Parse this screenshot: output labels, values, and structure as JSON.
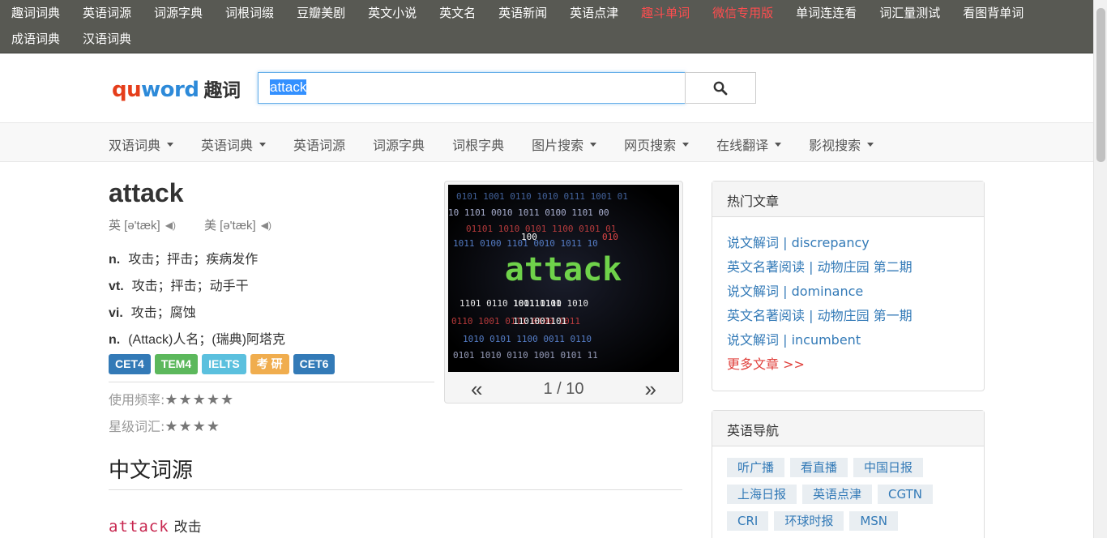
{
  "topbar": {
    "row1": [
      {
        "label": "趣词词典",
        "highlight": false
      },
      {
        "label": "英语词源",
        "highlight": false
      },
      {
        "label": "词源字典",
        "highlight": false
      },
      {
        "label": "词根词缀",
        "highlight": false
      },
      {
        "label": "豆瓣美剧",
        "highlight": false
      },
      {
        "label": "英文小说",
        "highlight": false
      },
      {
        "label": "英文名",
        "highlight": false
      },
      {
        "label": "英语新闻",
        "highlight": false
      },
      {
        "label": "英语点津",
        "highlight": false
      },
      {
        "label": "趣斗单词",
        "highlight": true
      },
      {
        "label": "微信专用版",
        "highlight": true
      },
      {
        "label": "单词连连看",
        "highlight": false
      },
      {
        "label": "词汇量测试",
        "highlight": false
      },
      {
        "label": "看图背单词",
        "highlight": false
      }
    ],
    "row2": [
      {
        "label": "成语词典"
      },
      {
        "label": "汉语词典"
      }
    ]
  },
  "header": {
    "logo_qu": "qu",
    "logo_word": "word",
    "logo_cn": "趣词",
    "search_value": "attack",
    "search_icon": "search-icon"
  },
  "nav": [
    {
      "label": "双语词典",
      "dropdown": true
    },
    {
      "label": "英语词典",
      "dropdown": true
    },
    {
      "label": "英语词源",
      "dropdown": false
    },
    {
      "label": "词源字典",
      "dropdown": false
    },
    {
      "label": "词根字典",
      "dropdown": false
    },
    {
      "label": "图片搜索",
      "dropdown": true
    },
    {
      "label": "网页搜索",
      "dropdown": true
    },
    {
      "label": "在线翻译",
      "dropdown": true
    },
    {
      "label": "影视搜索",
      "dropdown": true
    }
  ],
  "word": {
    "headword": "attack",
    "uk_label": "英 [ə'tæk]",
    "us_label": "美 [ə'tæk]",
    "definitions": [
      {
        "pos": "n.",
        "text": "攻击；抨击；疾病发作"
      },
      {
        "pos": "vt.",
        "text": "攻击；抨击；动手干"
      },
      {
        "pos": "vi.",
        "text": "攻击；腐蚀"
      },
      {
        "pos": "n.",
        "text": "(Attack)人名；(瑞典)阿塔克"
      }
    ],
    "tags": [
      {
        "label": "CET4",
        "color": "#337ab7"
      },
      {
        "label": "TEM4",
        "color": "#5cb85c"
      },
      {
        "label": "IELTS",
        "color": "#5bc0de"
      },
      {
        "label": "考 研",
        "color": "#f0ad4e"
      },
      {
        "label": "CET6",
        "color": "#337ab7"
      }
    ],
    "freq_label": "使用频率:",
    "freq_stars": "★★★★★",
    "level_label": "星级词汇:",
    "level_stars": "★★★★"
  },
  "image": {
    "text": "attack",
    "pager": "1 / 10",
    "prev": "«",
    "next": "»"
  },
  "etymology": {
    "title": "中文词源",
    "word": "attack",
    "gloss": "改击"
  },
  "hot_articles": {
    "title": "热门文章",
    "items": [
      "说文解词 | discrepancy",
      "英文名著阅读 | 动物庄园 第二期",
      "说文解词 | dominance",
      "英文名著阅读 | 动物庄园 第一期",
      "说文解词 | incumbent"
    ],
    "more": "更多文章 >>"
  },
  "english_nav": {
    "title": "英语导航",
    "items": [
      "听广播",
      "看直播",
      "中国日报",
      "上海日报",
      "英语点津",
      "CGTN",
      "CRI",
      "环球时报",
      "MSN"
    ]
  }
}
